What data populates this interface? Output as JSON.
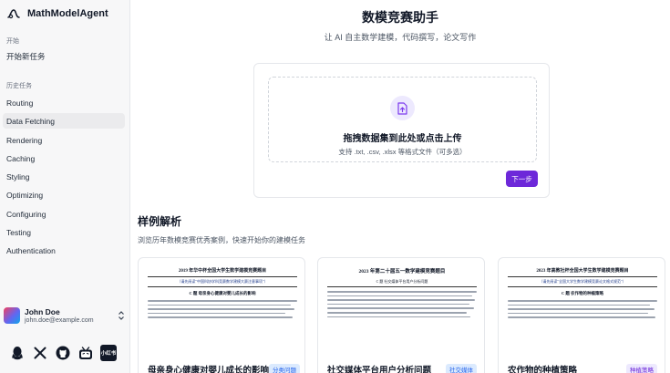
{
  "brand": {
    "name": "MathModelAgent"
  },
  "sidebar": {
    "start_label": "开始",
    "new_task": "开始新任务",
    "history_label": "历史任务",
    "items": [
      {
        "label": "Routing"
      },
      {
        "label": "Data Fetching"
      },
      {
        "label": "Rendering"
      },
      {
        "label": "Caching"
      },
      {
        "label": "Styling"
      },
      {
        "label": "Optimizing"
      },
      {
        "label": "Configuring"
      },
      {
        "label": "Testing"
      },
      {
        "label": "Authentication"
      }
    ],
    "active_index": 1
  },
  "user": {
    "name": "John Doe",
    "email": "john.doe@example.com"
  },
  "social": {
    "badge_text": "小红书",
    "icons": [
      "qq-icon",
      "x-icon",
      "github-icon",
      "bilibili-icon",
      "xiaohongshu-icon"
    ]
  },
  "main": {
    "title": "数模竞赛助手",
    "subtitle": "让 AI 自主数学建模，代码撰写，论文写作",
    "upload": {
      "title": "拖拽数据集到此处或点击上传",
      "hint": "支持 .txt, .csv, .xlsx 等格式文件（可多选）",
      "next_button": "下一步"
    },
    "examples": {
      "title": "样例解析",
      "description": "浏览历年数模竞赛优秀案例，快速开始你的建模任务",
      "cards": [
        {
          "paper_head": "2019 年华中杯全国大学生数学建模竞赛题目",
          "paper_sub": "（请先阅读\"中国科协学科竞赛数学建模大赛注意事项\"）",
          "paper_heading": "C 题  母亲身心健康对婴儿成长的影响",
          "title": "母亲身心健康对婴儿成长的影响",
          "tag": "分类问题"
        },
        {
          "paper_head": "2023 年第二十届五一数学建模竞赛题目",
          "paper_sub": "C 题  社交媒体平台用户分析问题",
          "paper_heading": "",
          "title": "社交媒体平台用户分析问题",
          "tag": "社交媒体"
        },
        {
          "paper_head": "2023 年高教社杯全国大学生数学建模竞赛题目",
          "paper_sub": "（请先阅读\"全国大学生数学建模竞赛论文格式规范\"）",
          "paper_heading": "C 题  农作物的种植策略",
          "title": "农作物的种植策略",
          "tag": "种植策略"
        }
      ]
    }
  },
  "colors": {
    "accent": "#6d28d9",
    "tag_blue_bg": "#dbeafe",
    "tag_blue_fg": "#2563eb",
    "tag_teal_bg": "#dbeafe",
    "tag_teal_fg": "#2563eb",
    "tag_purple_bg": "#ede9fe",
    "tag_purple_fg": "#6d28d9"
  }
}
